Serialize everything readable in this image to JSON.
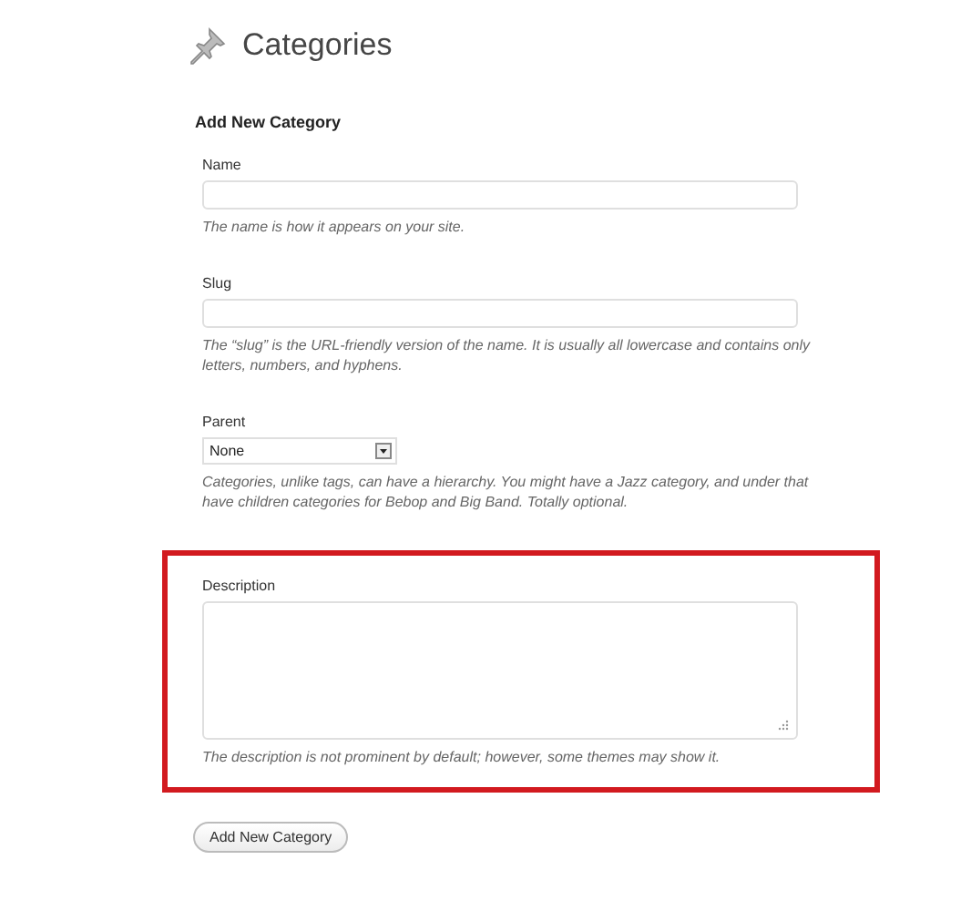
{
  "page": {
    "title": "Categories"
  },
  "form": {
    "heading": "Add New Category",
    "fields": [
      {
        "kind": "text",
        "label": "Name",
        "hint": "The name is how it appears on your site.",
        "highlighted": false
      },
      {
        "kind": "text",
        "label": "Slug",
        "hint": "The “slug” is the URL-friendly version of the name. It is usually all lowercase and contains only letters, numbers, and hyphens.",
        "highlighted": false
      },
      {
        "kind": "select",
        "label": "Parent",
        "value": "None",
        "hint": "Categories, unlike tags, can have a hierarchy. You might have a Jazz category, and under that have children categories for Bebop and Big Band. Totally optional.",
        "highlighted": false
      },
      {
        "kind": "textarea",
        "label": "Description",
        "hint": "The description is not prominent by default; however, some themes may show it.",
        "highlighted": true
      }
    ],
    "submit": "Add New Category"
  }
}
